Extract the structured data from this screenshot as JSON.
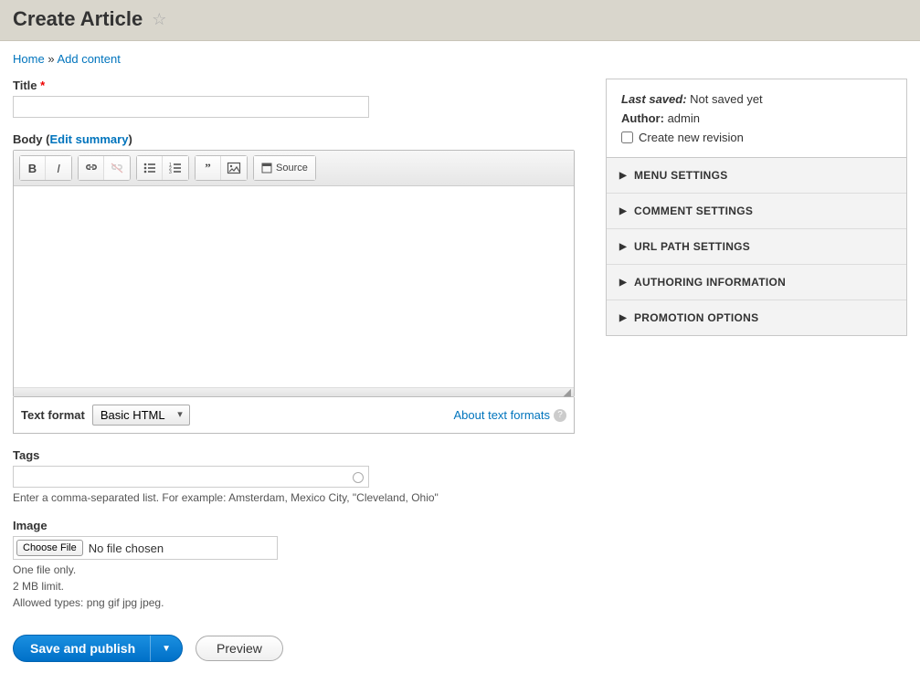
{
  "header": {
    "title": "Create Article"
  },
  "breadcrumb": {
    "home": "Home",
    "sep": "»",
    "add_content": "Add content"
  },
  "fields": {
    "title_label": "Title",
    "body_label_prefix": "Body (",
    "body_label_link": "Edit summary",
    "body_label_suffix": ")",
    "text_format_label": "Text format",
    "text_format_value": "Basic HTML",
    "about_formats": "About text formats",
    "tags_label": "Tags",
    "tags_hint": "Enter a comma-separated list. For example: Amsterdam, Mexico City, \"Cleveland, Ohio\"",
    "image_label": "Image",
    "choose_file": "Choose File",
    "no_file": "No file chosen",
    "file_hint_1": "One file only.",
    "file_hint_2": "2 MB limit.",
    "file_hint_3": "Allowed types: png gif jpg jpeg."
  },
  "editor": {
    "source_label": "Source"
  },
  "sidebar": {
    "last_saved_label": "Last saved:",
    "last_saved_value": "Not saved yet",
    "author_label": "Author:",
    "author_value": "admin",
    "new_revision": "Create new revision",
    "sections": [
      "MENU SETTINGS",
      "COMMENT SETTINGS",
      "URL PATH SETTINGS",
      "AUTHORING INFORMATION",
      "PROMOTION OPTIONS"
    ]
  },
  "actions": {
    "save": "Save and publish",
    "preview": "Preview"
  }
}
